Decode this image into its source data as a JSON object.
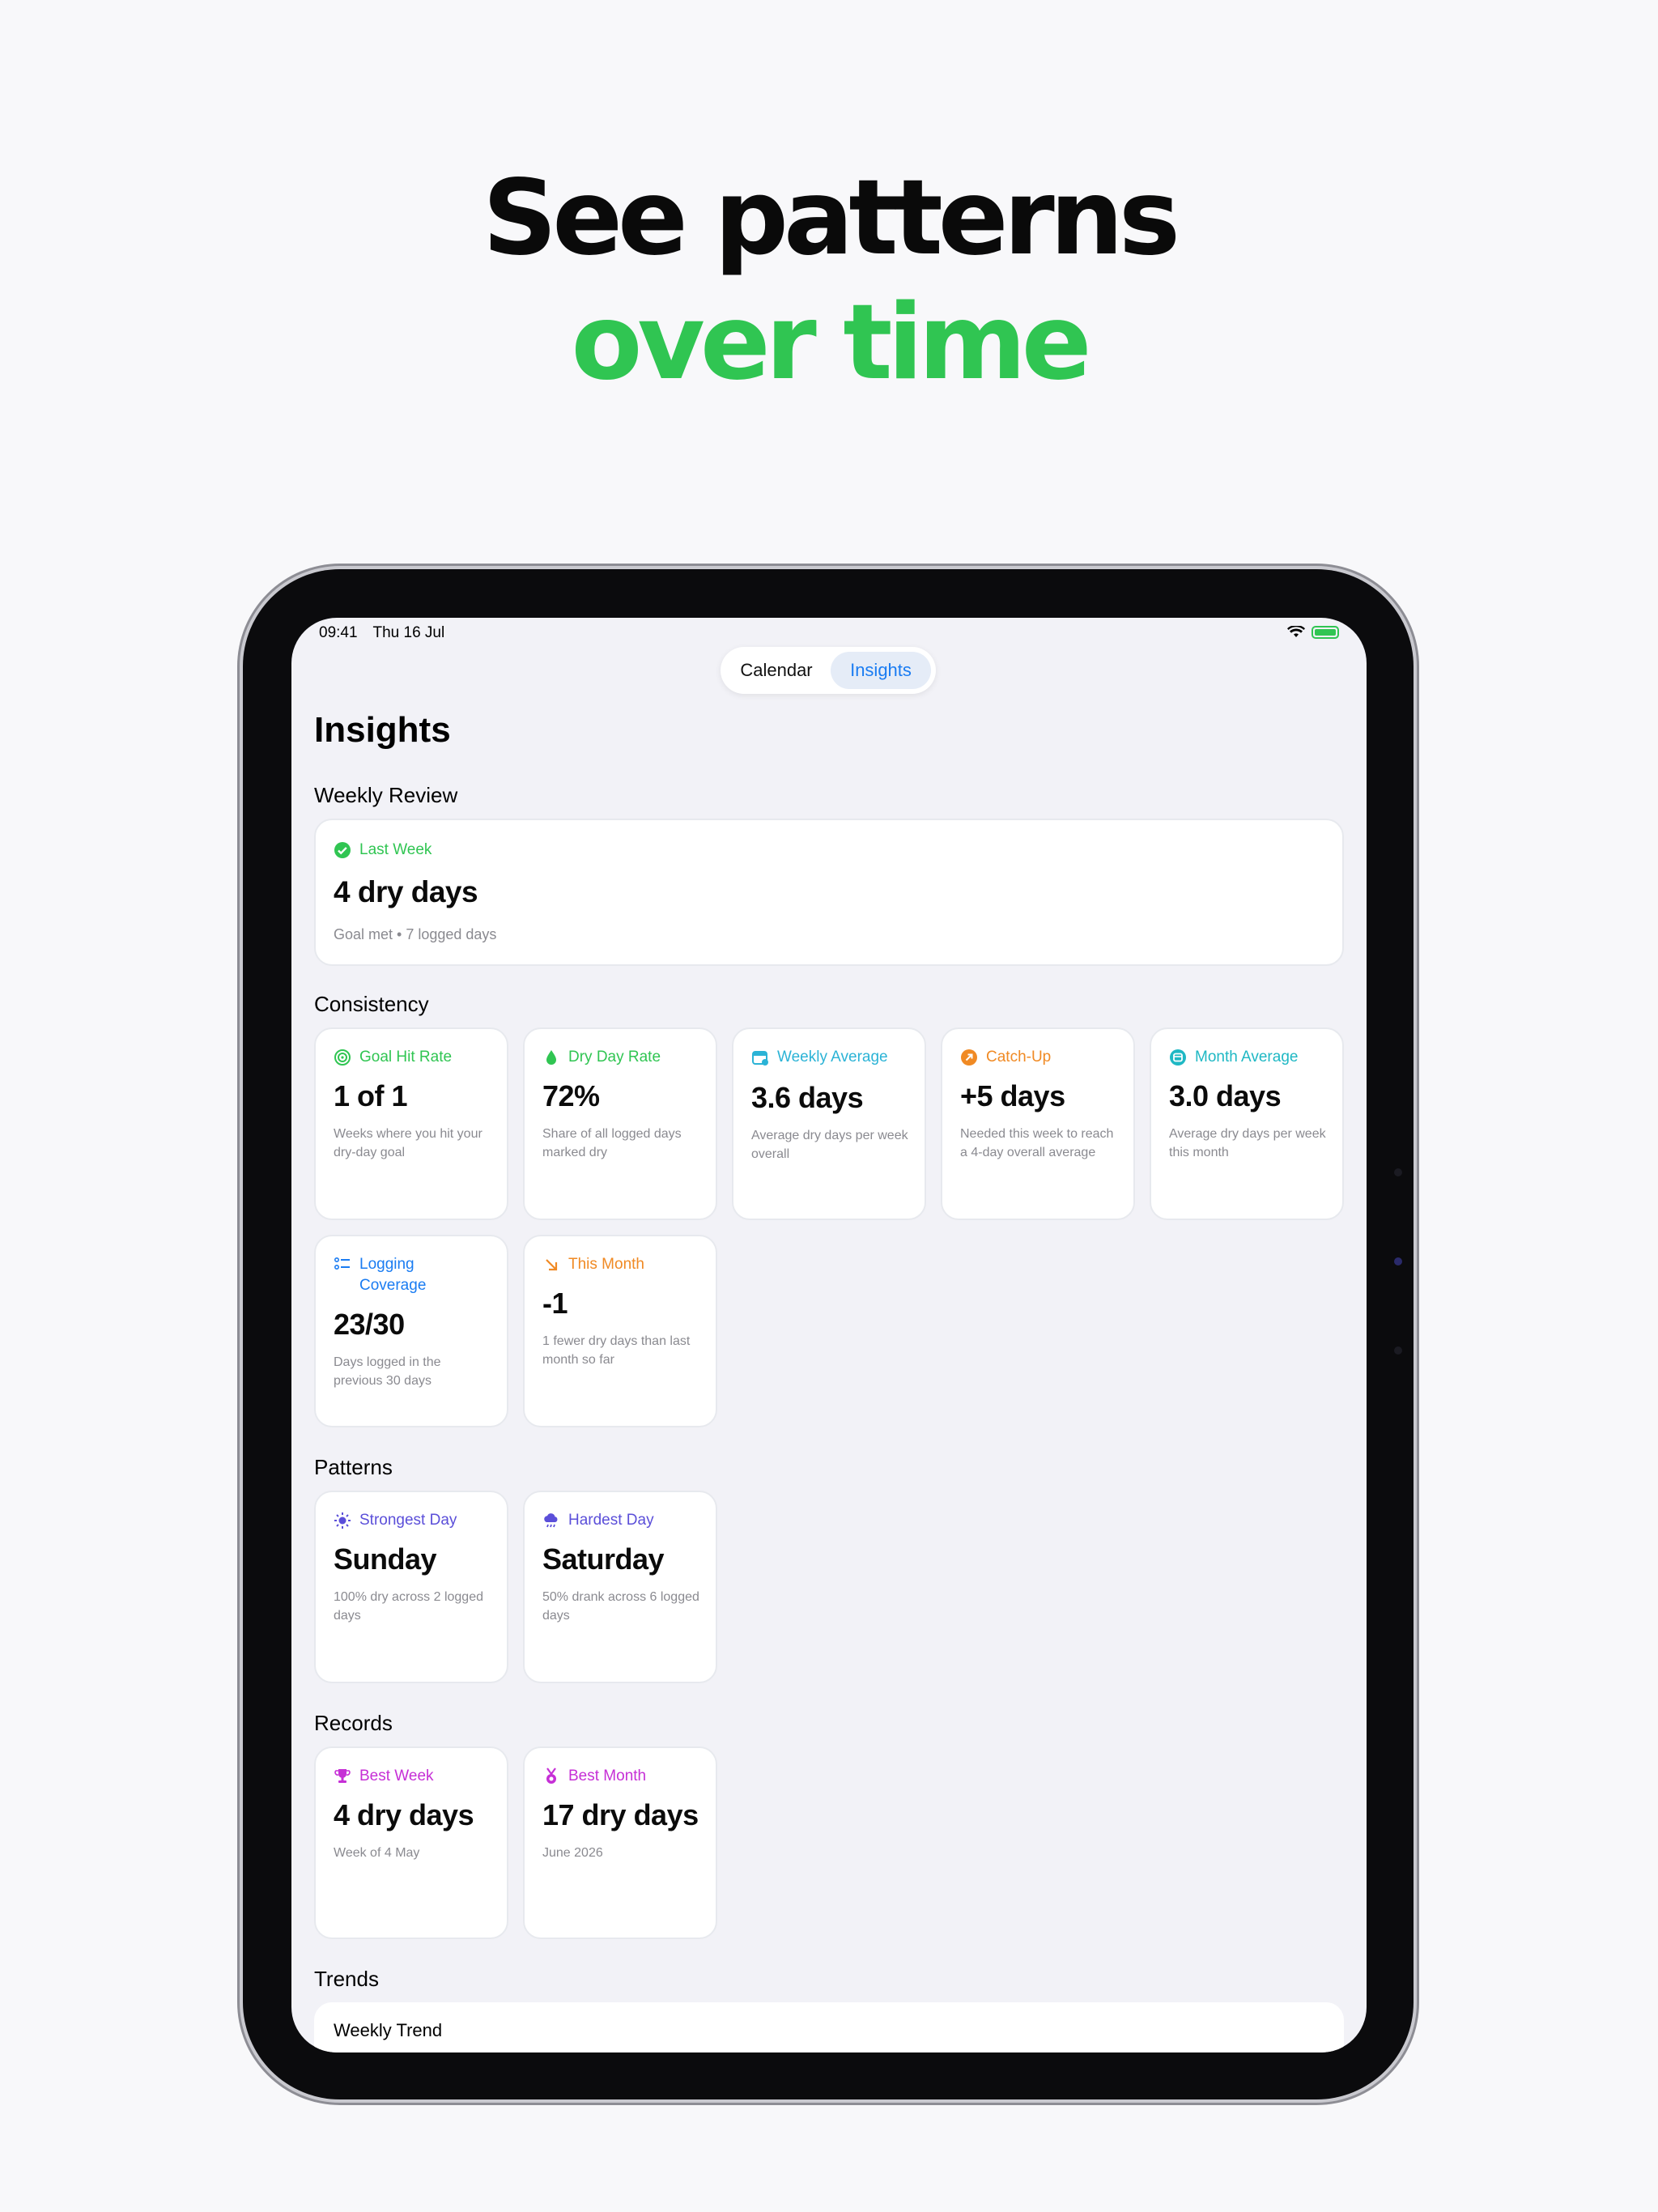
{
  "headline": {
    "line1": "See patterns",
    "line2": "over time"
  },
  "status_bar": {
    "time": "09:41",
    "date": "Thu 16 Jul"
  },
  "segmented": {
    "calendar": "Calendar",
    "insights": "Insights",
    "selected": "Insights"
  },
  "page_title": "Insights",
  "weekly_review": {
    "section": "Weekly Review",
    "label": "Last Week",
    "value": "4 dry days",
    "detail": "Goal met • 7 logged days"
  },
  "consistency": {
    "section": "Consistency",
    "cards": [
      {
        "label": "Goal Hit Rate",
        "value": "1 of 1",
        "desc": "Weeks where you hit your dry-day goal",
        "color": "#30c552",
        "icon": "target-icon"
      },
      {
        "label": "Dry Day Rate",
        "value": "72%",
        "desc": "Share of all logged days marked dry",
        "color": "#30c552",
        "icon": "drop-icon"
      },
      {
        "label": "Weekly Average",
        "value": "3.6 days",
        "desc": "Average dry days per week overall",
        "color": "#2bb3d6",
        "icon": "calendar-icon"
      },
      {
        "label": "Catch-Up",
        "value": "+5 days",
        "desc": "Needed this week to reach a 4-day overall average",
        "color": "#f08a24",
        "icon": "arrow-circle-icon"
      },
      {
        "label": "Month Average",
        "value": "3.0 days",
        "desc": "Average dry days per week this month",
        "color": "#1fb8c4",
        "icon": "month-icon"
      },
      {
        "label": "Logging Coverage",
        "value": "23/30",
        "desc": "Days logged in the previous 30 days",
        "color": "#1a7cf2",
        "icon": "list-icon"
      },
      {
        "label": "This Month",
        "value": "-1",
        "desc": "1 fewer dry days than last month so far",
        "color": "#f08a24",
        "icon": "arrow-down-right-icon"
      }
    ]
  },
  "patterns": {
    "section": "Patterns",
    "cards": [
      {
        "label": "Strongest Day",
        "value": "Sunday",
        "desc": "100% dry across 2 logged days",
        "color": "#5b4fd9",
        "icon": "sun-icon"
      },
      {
        "label": "Hardest Day",
        "value": "Saturday",
        "desc": "50% drank across 6 logged days",
        "color": "#5b4fd9",
        "icon": "cloud-rain-icon"
      }
    ]
  },
  "records": {
    "section": "Records",
    "cards": [
      {
        "label": "Best Week",
        "value": "4 dry days",
        "desc": "Week of 4 May",
        "color": "#c62fd6",
        "icon": "trophy-icon"
      },
      {
        "label": "Best Month",
        "value": "17 dry days",
        "desc": "June 2026",
        "color": "#c62fd6",
        "icon": "medal-icon"
      }
    ]
  },
  "trends": {
    "section": "Trends",
    "weekly_trend": "Weekly Trend"
  },
  "colors": {
    "accent_green": "#30c552",
    "accent_blue": "#1a7cf2"
  }
}
